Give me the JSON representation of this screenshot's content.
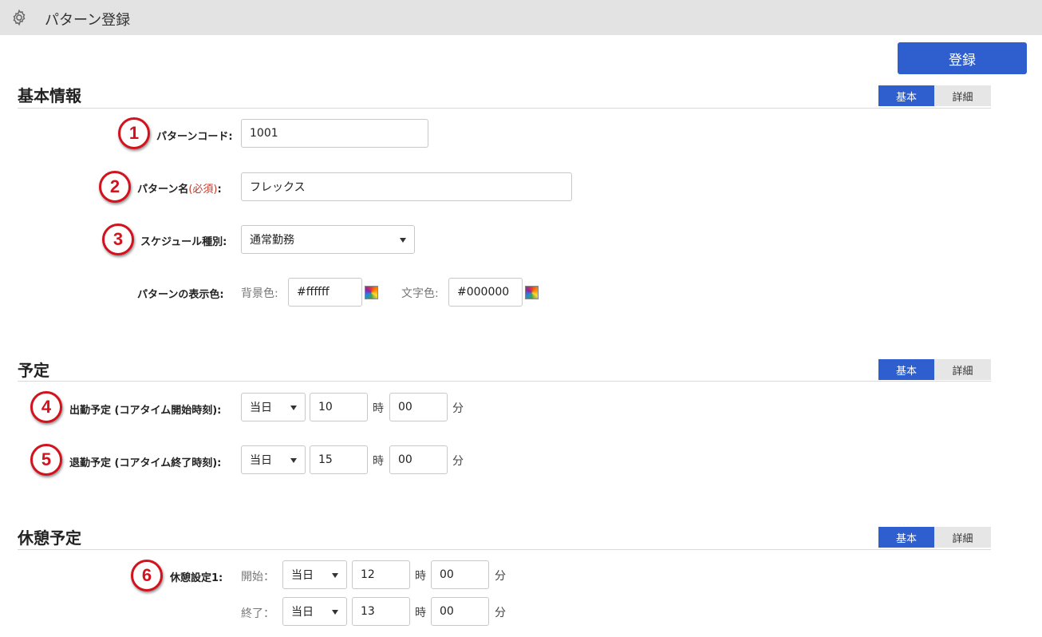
{
  "header": {
    "title": "パターン登録",
    "icon": "gear-icon"
  },
  "toolbar": {
    "register_label": "登録"
  },
  "toggle": {
    "basic": "基本",
    "detail": "詳細"
  },
  "colors": {
    "accent": "#2f5fcf",
    "badge": "#d4121d",
    "required": "#c0392b"
  },
  "basic_info": {
    "title": "基本情報",
    "pattern_code": {
      "badge": "1",
      "label": "パターンコード:",
      "value": "1001"
    },
    "pattern_name": {
      "badge": "2",
      "label": "パターン名",
      "required": "(必須)",
      "colon": ":",
      "value": "フレックス"
    },
    "schedule_type": {
      "badge": "3",
      "label": "スケジュール種別:",
      "value": "通常勤務"
    },
    "display_color": {
      "label": "パターンの表示色:",
      "bg_label": "背景色:",
      "bg_value": "#ffffff",
      "text_label": "文字色:",
      "text_value": "#000000"
    }
  },
  "schedule": {
    "title": "予定",
    "start": {
      "badge": "4",
      "label": "出勤予定 (コアタイム開始時刻):",
      "day": "当日",
      "hour": "10",
      "minute": "00"
    },
    "end": {
      "badge": "5",
      "label": "退勤予定 (コアタイム終了時刻):",
      "day": "当日",
      "hour": "15",
      "minute": "00"
    },
    "hour_unit": "時",
    "minute_unit": "分"
  },
  "break": {
    "title": "休憩予定",
    "setting1": {
      "badge": "6",
      "label": "休憩設定1:",
      "start": {
        "label": "開始：",
        "day": "当日",
        "hour": "12",
        "minute": "00"
      },
      "end": {
        "label": "終了：",
        "day": "当日",
        "hour": "13",
        "minute": "00"
      }
    },
    "hour_unit": "時",
    "minute_unit": "分"
  }
}
